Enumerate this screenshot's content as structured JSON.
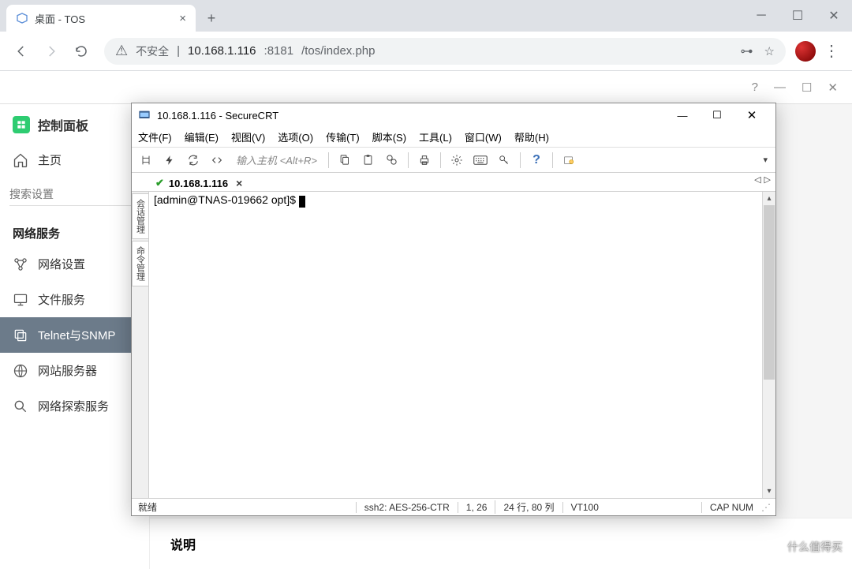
{
  "browser": {
    "tab_title": "桌面 - TOS",
    "insecure_label": "不安全",
    "url_host": "10.168.1.116",
    "url_port": ":8181",
    "url_path": "/tos/index.php"
  },
  "sidebar": {
    "panel_title": "控制面板",
    "home_label": "主页",
    "search_placeholder": "搜索设置",
    "section_label": "网络服务",
    "items": [
      {
        "label": "网络设置"
      },
      {
        "label": "文件服务"
      },
      {
        "label": "Telnet与SNMP"
      },
      {
        "label": "网站服务器"
      },
      {
        "label": "网络探索服务"
      }
    ]
  },
  "content": {
    "footer_heading": "说明"
  },
  "crt": {
    "title": "10.168.1.116 - SecureCRT",
    "menu": [
      "文件(F)",
      "编辑(E)",
      "视图(V)",
      "选项(O)",
      "传输(T)",
      "脚本(S)",
      "工具(L)",
      "窗口(W)",
      "帮助(H)"
    ],
    "host_placeholder": "输入主机 <Alt+R>",
    "tab_label": "10.168.1.116",
    "side_tabs": [
      "会话管理",
      "命令管理"
    ],
    "prompt": "[admin@TNAS-019662 opt]$ ",
    "status": {
      "ready": "就绪",
      "cipher": "ssh2: AES-256-CTR",
      "cursor": "1,  26",
      "size": "24 行, 80 列",
      "term": "VT100",
      "caps": "CAP NUM"
    }
  },
  "watermark": {
    "badge": "值",
    "text": "什么值得买"
  }
}
